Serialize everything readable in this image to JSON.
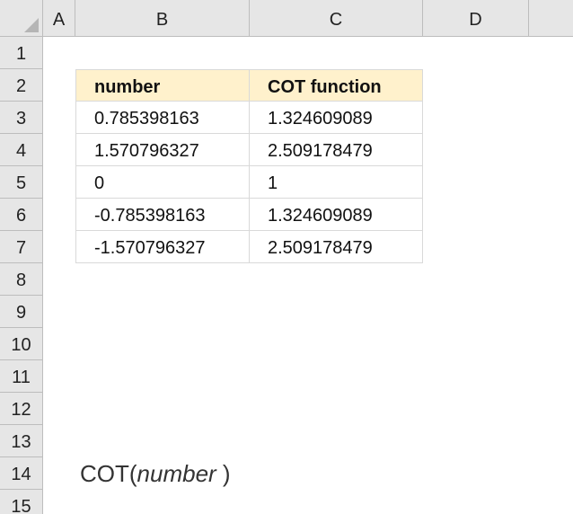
{
  "columns": [
    "A",
    "B",
    "C",
    "D"
  ],
  "rows": [
    "1",
    "2",
    "3",
    "4",
    "5",
    "6",
    "7",
    "8",
    "9",
    "10",
    "11",
    "12",
    "13",
    "14",
    "15"
  ],
  "table": {
    "headers": [
      "number",
      "COT function"
    ],
    "rows": [
      [
        "0.785398163",
        "1.324609089"
      ],
      [
        "1.570796327",
        "2.509178479"
      ],
      [
        "0",
        "1"
      ],
      [
        "-0.785398163",
        "1.324609089"
      ],
      [
        "-1.570796327",
        "2.509178479"
      ]
    ]
  },
  "syntax": {
    "fn": "COT(",
    "arg": "number",
    "close": " )"
  },
  "colors": {
    "header_fill": "#fff1cc",
    "grid_header_bg": "#e6e6e6",
    "gridline": "#d9d9d9"
  }
}
